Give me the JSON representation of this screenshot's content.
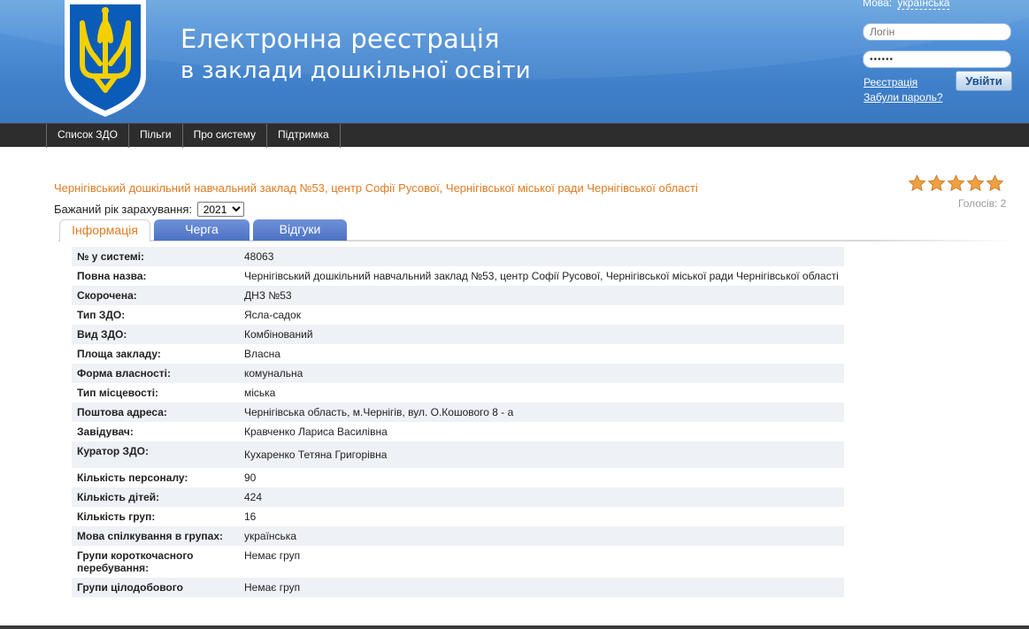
{
  "header": {
    "title_line1": "Електронна реєстрація",
    "title_line2": "в заклади дошкільної освіти",
    "lang_label": "Мова:",
    "lang_value": "українська",
    "login_placeholder": "Логін",
    "password_value": "••••••",
    "register_link": "Реєстрація",
    "forgot_link": "Забули пароль?",
    "login_button": "Увійти",
    "emblem_icon": "trident-coat-of-arms-icon"
  },
  "nav": {
    "items": [
      {
        "label": "Список ЗДО"
      },
      {
        "label": "Пільги"
      },
      {
        "label": "Про систему"
      },
      {
        "label": "Підтримка"
      }
    ]
  },
  "institution": {
    "title": "Чернігівський дошкільний навчальний заклад №53, центр Софії Русової, Чернігівської міської ради Чернігівської області",
    "year_label": "Бажаний рік зарахування:",
    "year_value": "2021",
    "rating": 5,
    "votes": "Голосів: 2"
  },
  "tabs": [
    {
      "label": "Інформація",
      "active": true
    },
    {
      "label": "Черга",
      "active": false
    },
    {
      "label": "Відгуки",
      "active": false
    }
  ],
  "info_rows": [
    {
      "k": "№ у системі:",
      "v": "48063"
    },
    {
      "k": "Повна назва:",
      "v": "Чернігівський дошкільний навчальний заклад №53, центр Софії Русової, Чернігівської міської ради Чернігівської області"
    },
    {
      "k": "Скорочена:",
      "v": "ДНЗ №53"
    },
    {
      "k": "Тип ЗДО:",
      "v": "Ясла-садок"
    },
    {
      "k": "Вид ЗДО:",
      "v": "Комбінований"
    },
    {
      "k": "Площа закладу:",
      "v": "Власна"
    },
    {
      "k": "Форма власності:",
      "v": "комунальна"
    },
    {
      "k": "Тип місцевості:",
      "v": "міська"
    },
    {
      "k": "Поштова адреса:",
      "v": "Чернігівська область, м.Чернігів, вул. О.Кошового 8 - а"
    },
    {
      "k": "Завідувач:",
      "v": "Кравченко Лариса Василівна"
    },
    {
      "k": "Куратор ЗДО:",
      "v": "Кухаренко Тетяна Григорівна"
    },
    {
      "k": "Кількість персоналу:",
      "v": "90"
    },
    {
      "k": "Кількість дітей:",
      "v": "424"
    },
    {
      "k": "Кількість груп:",
      "v": "16"
    },
    {
      "k": "Мова спілкування в групах:",
      "v": "українська"
    },
    {
      "k": "Групи короткочасного перебування:",
      "v": "Немає груп"
    },
    {
      "k": "Групи цілодобового",
      "v": "Немає груп"
    }
  ],
  "colors": {
    "header_blue": "#4f8fd6",
    "navbar": "#2d2d2d",
    "accent_orange": "#e07a20",
    "tab_blue": "#5a7fcf",
    "row_alt": "#eef1f6"
  }
}
